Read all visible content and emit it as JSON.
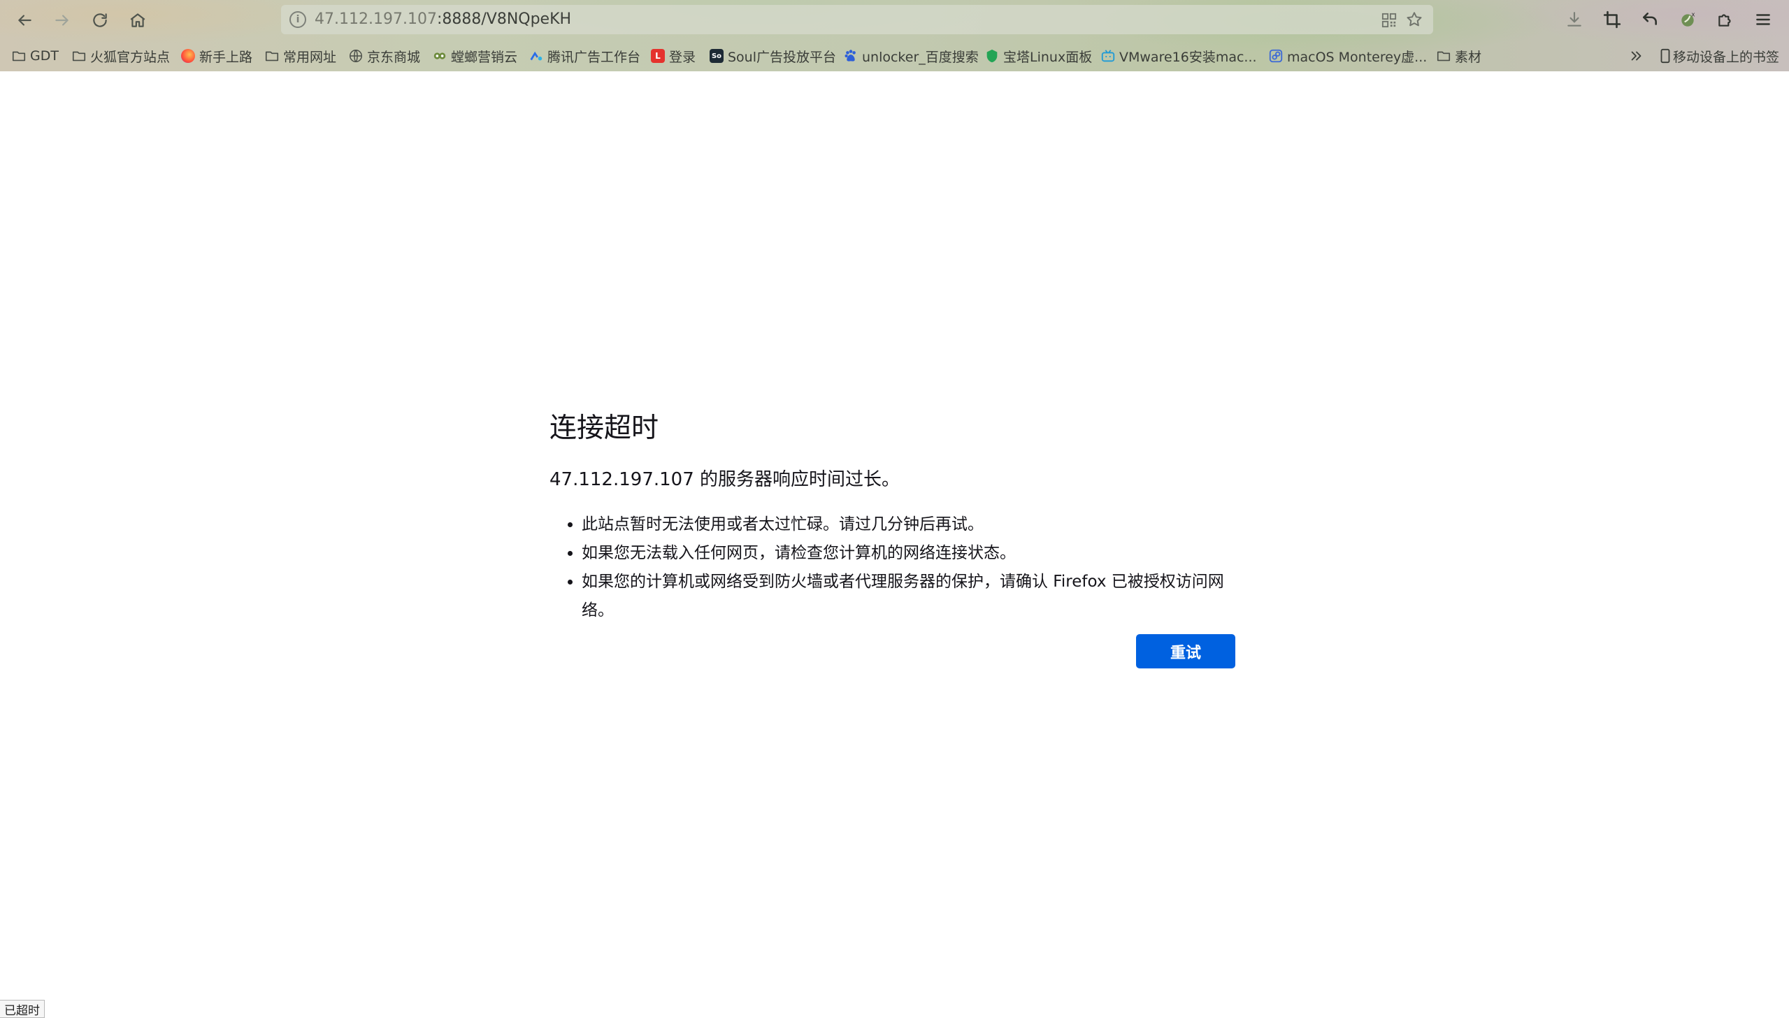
{
  "browser": {
    "url_host": "47.112.197.107",
    "url_rest": ":8888/V8NQpeKH",
    "bookmarks": [
      {
        "label": "GDT",
        "icon": "folder-icon"
      },
      {
        "label": "火狐官方站点",
        "icon": "folder-icon"
      },
      {
        "label": "新手上路",
        "icon": "firefox-icon"
      },
      {
        "label": "常用网址",
        "icon": "folder-icon"
      },
      {
        "label": "京东商城",
        "icon": "globe-icon"
      },
      {
        "label": "螳螂营销云",
        "icon": "mantis-icon"
      },
      {
        "label": "腾讯广告工作台",
        "icon": "tencent-ads-icon"
      },
      {
        "label": "登录",
        "icon": "l-icon"
      },
      {
        "label": "Soul广告投放平台",
        "icon": "soul-icon"
      },
      {
        "label": "unlocker_百度搜索",
        "icon": "baidu-icon"
      },
      {
        "label": "宝塔Linux面板",
        "icon": "bt-icon"
      },
      {
        "label": "VMware16安装mac...",
        "icon": "bilibili-icon"
      },
      {
        "label": "macOS Monterey虚...",
        "icon": "blog-icon"
      },
      {
        "label": "素材",
        "icon": "folder-icon"
      }
    ],
    "mobile_bookmarks": "移动设备上的书签"
  },
  "error": {
    "title": "连接超时",
    "description": "47.112.197.107 的服务器响应时间过长。",
    "items": [
      "此站点暂时无法使用或者太过忙碌。请过几分钟后再试。",
      "如果您无法载入任何网页，请检查您计算机的网络连接状态。",
      "如果您的计算机或网络受到防火墙或者代理服务器的保护，请确认 Firefox 已被授权访问网络。"
    ],
    "retry_label": "重试"
  },
  "status_bar": "已超时",
  "colors": {
    "accent": "#0061e0",
    "text": "#15141a"
  }
}
